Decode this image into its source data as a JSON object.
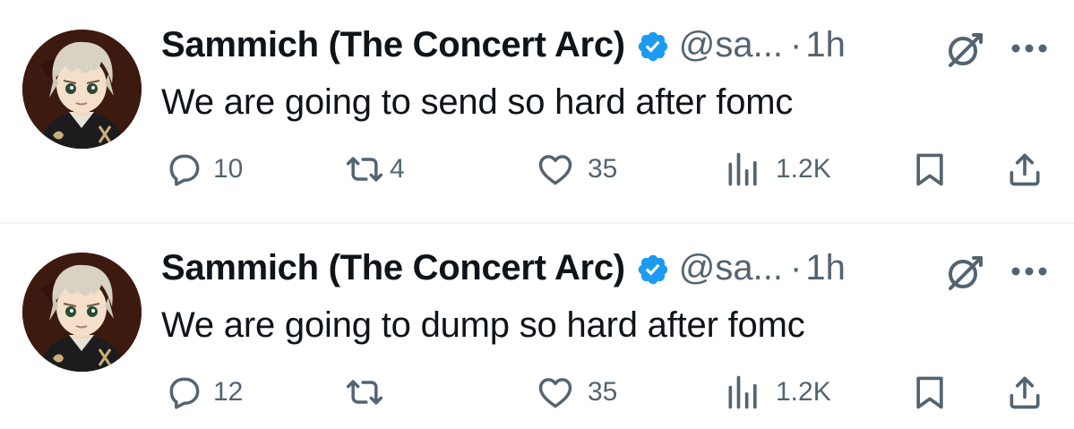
{
  "tweets": [
    {
      "display_name": "Sammich (The Concert Arc)",
      "handle": "@sa...",
      "separator": "·",
      "time": "1h",
      "text": "We are going to send so hard after fomc",
      "replies": "10",
      "reposts": "4",
      "likes": "35",
      "views": "1.2K"
    },
    {
      "display_name": "Sammich (The Concert Arc)",
      "handle": "@sa...",
      "separator": "·",
      "time": "1h",
      "text": "We are going to dump so hard after fomc",
      "replies": "12",
      "reposts": "",
      "likes": "35",
      "views": "1.2K"
    }
  ],
  "colors": {
    "verified": "#1d9bf0",
    "secondary_text": "#536471",
    "primary_text": "#0f1419",
    "divider": "#eff3f4"
  },
  "icons": [
    "verified-badge-icon",
    "grok-icon",
    "more-icon",
    "reply-icon",
    "repost-icon",
    "like-icon",
    "views-icon",
    "bookmark-icon",
    "share-icon"
  ]
}
